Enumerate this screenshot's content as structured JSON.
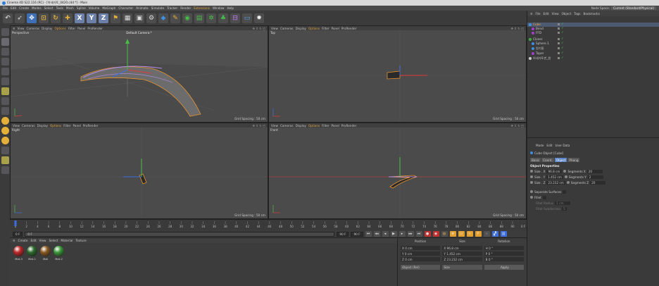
{
  "window": {
    "title": "Cinema 4D S22.116 (RC) - [아세가토_0420.c4d *] - Main"
  },
  "menubar": {
    "items": [
      "File",
      "Edit",
      "Create",
      "Modes",
      "Select",
      "Tools",
      "Mesh",
      "Spline",
      "Volume",
      "MoGraph",
      "Character",
      "Animate",
      "Simulate",
      "Tracker",
      "Render",
      "Extensions",
      "Window",
      "Help"
    ],
    "highlight": "Extensions",
    "node_space_label": "Node Space:",
    "node_space_value": "Current (Standard/Physical)"
  },
  "toolbar": {
    "icons": [
      "undo-icon",
      "select-icon",
      "move-icon",
      "scale-icon",
      "rotate-icon",
      "recent-tool-icon",
      "x-axis-icon",
      "y-axis-icon",
      "z-axis-icon",
      "coordinate-system-icon",
      "render-region-icon",
      "render-view-icon",
      "render-settings-icon",
      "cube-icon",
      "pen-icon",
      "subdivision-icon",
      "array-icon",
      "mograph-icon",
      "deformer-icon",
      "scene-icon",
      "camera-icon",
      "light-icon"
    ]
  },
  "viewports": {
    "menu": [
      "View",
      "Cameras",
      "Display",
      "Options",
      "Filter",
      "Panel",
      "ProRender"
    ],
    "menu_highlight": "Options",
    "perspective": {
      "name": "Perspective",
      "camera": "Default Camera:*",
      "grid": "Grid Spacing : 50 cm"
    },
    "top": {
      "name": "Top",
      "grid": "Grid Spacing : 50 cm"
    },
    "right": {
      "name": "Right",
      "grid": "Grid Spacing : 50 cm"
    },
    "front": {
      "name": "Front",
      "grid": "Grid Spacing : 50 cm"
    }
  },
  "timeline": {
    "ticks": [
      "0",
      "2",
      "4",
      "6",
      "8",
      "10",
      "12",
      "14",
      "16",
      "18",
      "20",
      "22",
      "24",
      "26",
      "28",
      "30",
      "32",
      "34",
      "36",
      "38",
      "40",
      "42",
      "44",
      "46",
      "48",
      "50",
      "52",
      "54",
      "56",
      "58",
      "60",
      "62",
      "64",
      "66",
      "68",
      "70",
      "72",
      "74",
      "76",
      "78",
      "80",
      "82",
      "84",
      "86",
      "88",
      "90"
    ],
    "end_frame": "0 F",
    "current_frame": "0 F",
    "min_field": "0 F",
    "max_field": "90 F",
    "max_field2": "90 F"
  },
  "materials": {
    "menu": [
      "Create",
      "Edit",
      "View",
      "Select",
      "Material",
      "Texture"
    ],
    "items": [
      {
        "name": "Mat.3",
        "color": "#c0282a"
      },
      {
        "name": "Mat.1",
        "color": "#2e6b2e"
      },
      {
        "name": "Mat",
        "color": "#8a5a22"
      },
      {
        "name": "Mat.2",
        "color": "#3c9a3c"
      }
    ]
  },
  "coordinates": {
    "headers": {
      "position": "Position",
      "size": "Size",
      "rotation": "Rotation"
    },
    "rows": [
      {
        "axis": "X",
        "pos": "0 cm",
        "size_axis": "X",
        "size": "96.8 cm",
        "rot_axis": "H",
        "rot": "0 °"
      },
      {
        "axis": "Y",
        "pos": "0 cm",
        "size_axis": "Y",
        "size": "1.452 cm",
        "rot_axis": "P",
        "rot": "0 °"
      },
      {
        "axis": "Z",
        "pos": "0 cm",
        "size_axis": "Z",
        "size": "23.232 cm",
        "rot_axis": "B",
        "rot": "0 °"
      }
    ],
    "mode": "Object (Rel)",
    "size_mode": "Size",
    "apply_label": "Apply"
  },
  "object_manager": {
    "menu": [
      "File",
      "Edit",
      "View",
      "Object",
      "Tags",
      "Bookmarks"
    ],
    "objects": [
      {
        "name": "Cube",
        "color": "#3d8fe0",
        "selected": true
      },
      {
        "name": "Bend",
        "color": "#a040d0",
        "selected": false
      },
      {
        "name": "FFD",
        "color": "#a040d0",
        "selected": false
      },
      {
        "name": "Cloner",
        "color": "#3db03d",
        "selected": false
      },
      {
        "name": "Sphere.1",
        "color": "#3d8fe0",
        "selected": false
      },
      {
        "name": "원기둥",
        "color": "#3d8fe0",
        "selected": false
      },
      {
        "name": "Taper",
        "color": "#a040d0",
        "selected": false
      },
      {
        "name": "아세가토판_원",
        "color": "#cccccc",
        "selected": false
      }
    ]
  },
  "attributes": {
    "menu": [
      "Mode",
      "Edit",
      "User Data"
    ],
    "object_label": "Cube Object [Cube]",
    "tabs": [
      "Basic",
      "Coord.",
      "Object",
      "Phong"
    ],
    "active_tab": "Object",
    "section": "Object Properties",
    "size_x_label": "Size . X",
    "size_x": "96.8 cm",
    "size_y_label": "Size . Y",
    "size_y": "1.452 cm",
    "size_z_label": "Size . Z",
    "size_z": "23.232 cm",
    "seg_x_label": "Segments X",
    "seg_x": "20",
    "seg_y_label": "Segments Y",
    "seg_y": "2",
    "seg_z_label": "Segments Z",
    "seg_z": "20",
    "separate_label": "Separate Surfaces",
    "fillet_label": "Fillet",
    "fillet_radius_label": "Fillet Radius",
    "fillet_radius": "1 cm",
    "fillet_sub_label": "Fillet Subdivision",
    "fillet_sub": "5"
  }
}
